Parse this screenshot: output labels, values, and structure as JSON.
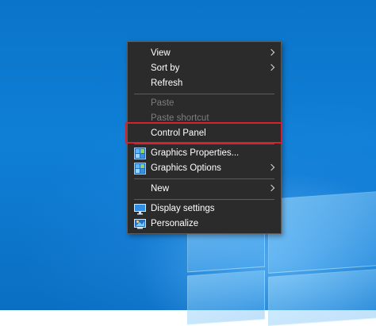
{
  "context_menu": {
    "items": [
      {
        "label": "View",
        "submenu": true,
        "enabled": true
      },
      {
        "label": "Sort by",
        "submenu": true,
        "enabled": true
      },
      {
        "label": "Refresh",
        "submenu": false,
        "enabled": true
      },
      {
        "label": "Paste",
        "submenu": false,
        "enabled": false
      },
      {
        "label": "Paste shortcut",
        "submenu": false,
        "enabled": false
      },
      {
        "label": "Control Panel",
        "submenu": false,
        "enabled": true,
        "highlighted": true
      },
      {
        "label": "Graphics Properties...",
        "submenu": false,
        "enabled": true,
        "icon": "intel-graphics-icon"
      },
      {
        "label": "Graphics Options",
        "submenu": true,
        "enabled": true,
        "icon": "intel-graphics-icon"
      },
      {
        "label": "New",
        "submenu": true,
        "enabled": true
      },
      {
        "label": "Display settings",
        "submenu": false,
        "enabled": true,
        "icon": "display-settings-icon"
      },
      {
        "label": "Personalize",
        "submenu": false,
        "enabled": true,
        "icon": "personalize-icon"
      }
    ]
  },
  "colors": {
    "menu_background": "#2b2b2b",
    "highlight_border": "#d6202d",
    "disabled_text": "#7d7d7d",
    "desktop_blue": "#0a74c9"
  }
}
